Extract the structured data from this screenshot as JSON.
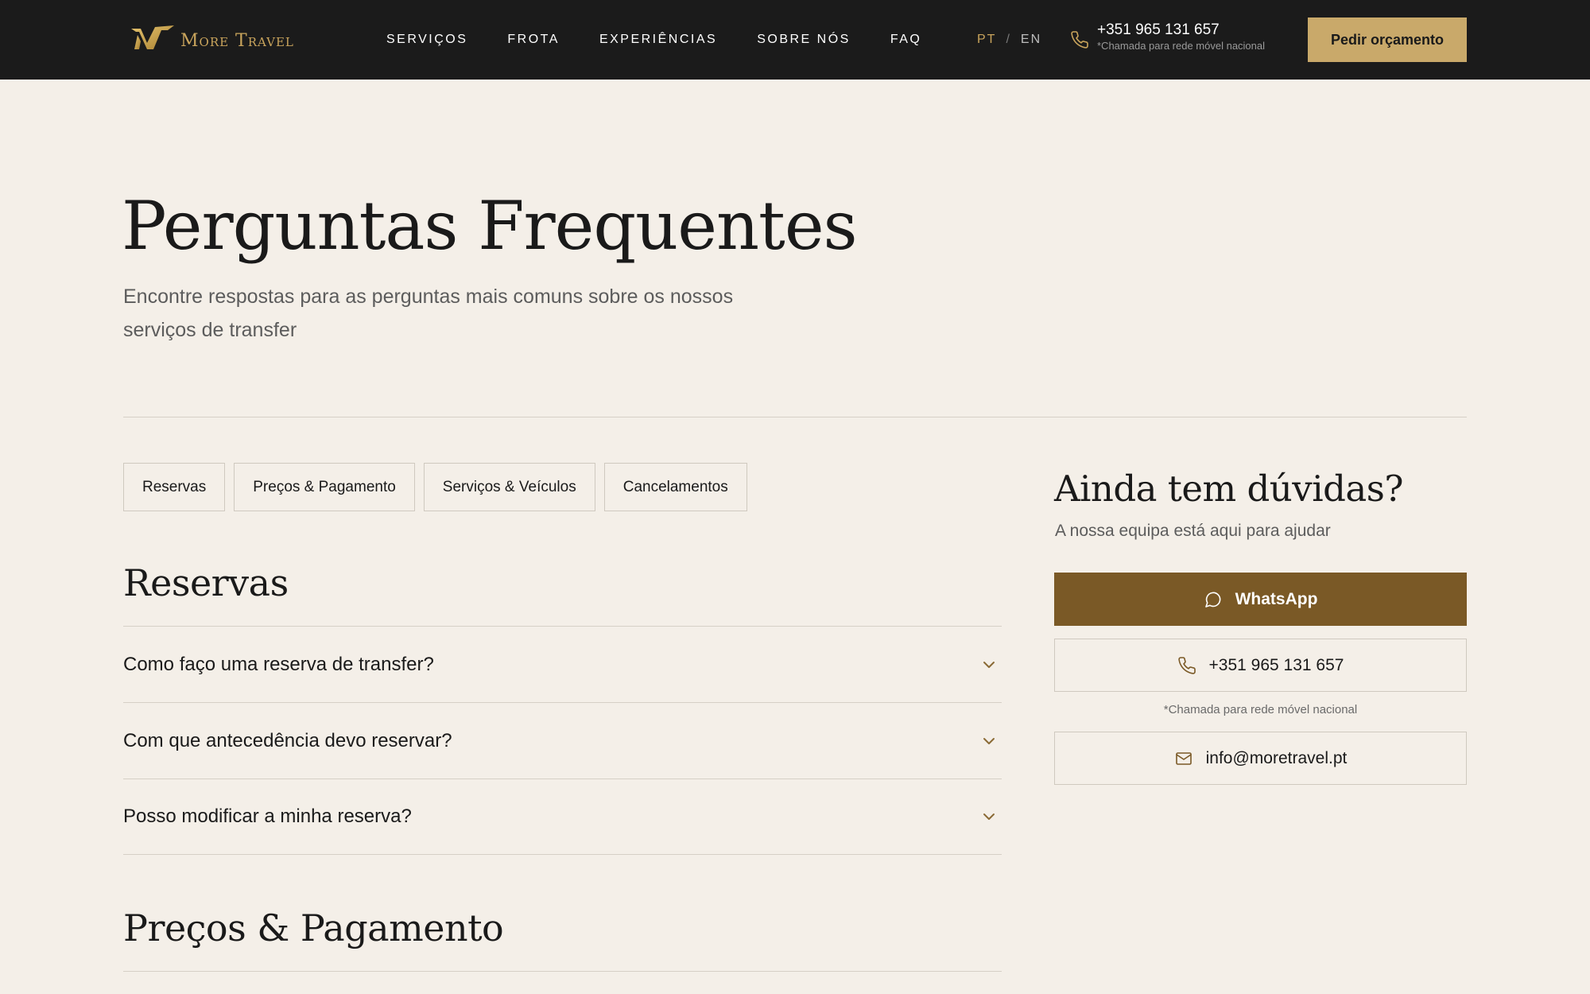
{
  "brand": {
    "name": "More Travel"
  },
  "nav": {
    "items": [
      {
        "label": "SERVIÇOS"
      },
      {
        "label": "FROTA"
      },
      {
        "label": "EXPERIÊNCIAS"
      },
      {
        "label": "SOBRE NÓS"
      },
      {
        "label": "FAQ"
      }
    ]
  },
  "lang": {
    "active": "PT",
    "separator": "/",
    "other": "EN"
  },
  "header_contact": {
    "phone": "+351 965 131 657",
    "note": "*Chamada para rede móvel nacional",
    "icon": "phone-icon"
  },
  "header_cta": {
    "label": "Pedir orçamento"
  },
  "hero": {
    "title": "Perguntas Frequentes",
    "subtitle": "Encontre respostas para as perguntas mais comuns sobre os nossos serviços de transfer"
  },
  "tabs": [
    {
      "label": "Reservas"
    },
    {
      "label": "Preços & Pagamento"
    },
    {
      "label": "Serviços & Veículos"
    },
    {
      "label": "Cancelamentos"
    }
  ],
  "faq": {
    "sections": [
      {
        "title": "Reservas",
        "questions": [
          {
            "q": "Como faço uma reserva de transfer?"
          },
          {
            "q": "Com que antecedência devo reservar?"
          },
          {
            "q": "Posso modificar a minha reserva?"
          }
        ]
      },
      {
        "title": "Preços & Pagamento"
      }
    ]
  },
  "sidebar": {
    "title": "Ainda tem dúvidas?",
    "subtitle": "A nossa equipa está aqui para ajudar",
    "whatsapp_label": "WhatsApp",
    "phone_label": "+351 965 131 657",
    "phone_note": "*Chamada para rede móvel nacional",
    "email_label": "info@moretravel.pt"
  },
  "colors": {
    "header_bg": "#1b1b1b",
    "page_bg": "#f4efe8",
    "gold": "#c9a96a",
    "whatsapp_bg": "#7a5926",
    "chevron": "#8a6a35"
  }
}
